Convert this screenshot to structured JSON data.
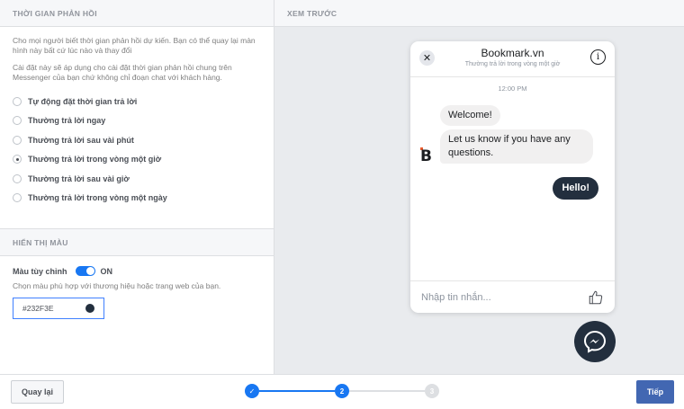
{
  "response_time": {
    "header": "THỜI GIAN PHẢN HỒI",
    "desc1": "Cho mọi người biết thời gian phản hồi dự kiến. Bạn có thể quay lại màn hình này bất cứ lúc nào và thay đổi",
    "desc2": "Cài đặt này sẽ áp dụng cho cài đặt thời gian phản hồi chung trên Messenger của bạn chứ không chỉ đoạn chat với khách hàng.",
    "options": [
      {
        "label": "Tự động đặt thời gian trả lời",
        "checked": false
      },
      {
        "label": "Thường trả lời ngay",
        "checked": false
      },
      {
        "label": "Thường trả lời sau vài phút",
        "checked": false
      },
      {
        "label": "Thường trả lời trong vòng một giờ",
        "checked": true
      },
      {
        "label": "Thường trả lời sau vài giờ",
        "checked": false
      },
      {
        "label": "Thường trả lời trong vòng một ngày",
        "checked": false
      }
    ]
  },
  "color_display": {
    "header": "HIỂN THỊ MÀU",
    "custom_label": "Màu tùy chỉnh",
    "toggle_state": "ON",
    "hint": "Chọn màu phù hợp với thương hiệu hoặc trang web của bạn.",
    "color_value": "#232F3E",
    "swatch_color": "#232f3e"
  },
  "preview": {
    "header": "XEM TRƯỚC",
    "chat_title": "Bookmark.vn",
    "chat_subtitle": "Thường trả lời trong vòng một giờ",
    "time": "12:00 PM",
    "messages": {
      "welcome": "Welcome!",
      "question": "Let us know if you have any questions.",
      "reply": "Hello!"
    },
    "avatar_letter": "B",
    "composer_placeholder": "Nhập tin nhắn...",
    "close_glyph": "✕",
    "info_glyph": "i"
  },
  "footer": {
    "back_label": "Quay lại",
    "next_label": "Tiếp",
    "steps": [
      {
        "label": "✓",
        "state": "done"
      },
      {
        "label": "2",
        "state": "active"
      },
      {
        "label": "3",
        "state": "pending"
      }
    ]
  },
  "colors": {
    "accent": "#1877f2",
    "primary_button": "#4267b2",
    "brand_dark": "#232f3e"
  }
}
